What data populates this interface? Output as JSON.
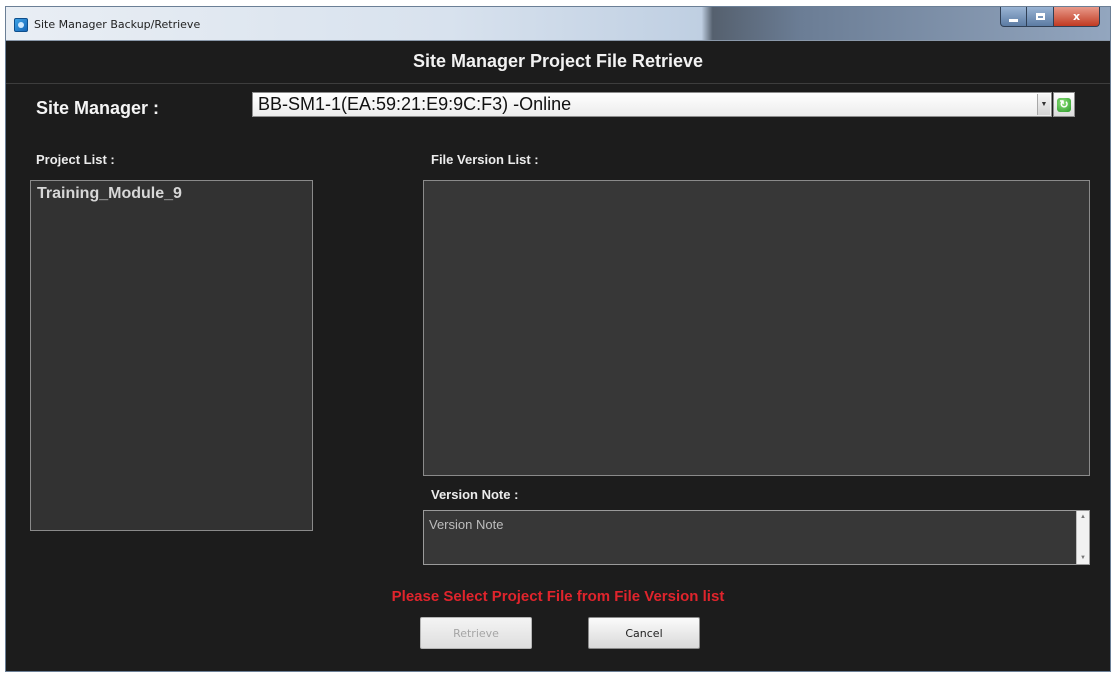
{
  "window": {
    "title": "Site Manager Backup/Retrieve",
    "close_glyph": "x"
  },
  "header": {
    "title": "Site Manager Project File Retrieve"
  },
  "site_manager": {
    "label": "Site Manager :",
    "selected": "BB-SM1-1(EA:59:21:E9:9C:F3) -Online"
  },
  "project_list": {
    "label": "Project List :",
    "items": [
      "Training_Module_9"
    ]
  },
  "file_version_list": {
    "label": "File Version List :",
    "items": []
  },
  "version_note": {
    "label": "Version Note :",
    "value": "Version Note"
  },
  "status": {
    "message": "Please Select Project File from File Version list",
    "color": "#e0242c"
  },
  "buttons": {
    "retrieve": "Retrieve",
    "cancel": "Cancel"
  }
}
